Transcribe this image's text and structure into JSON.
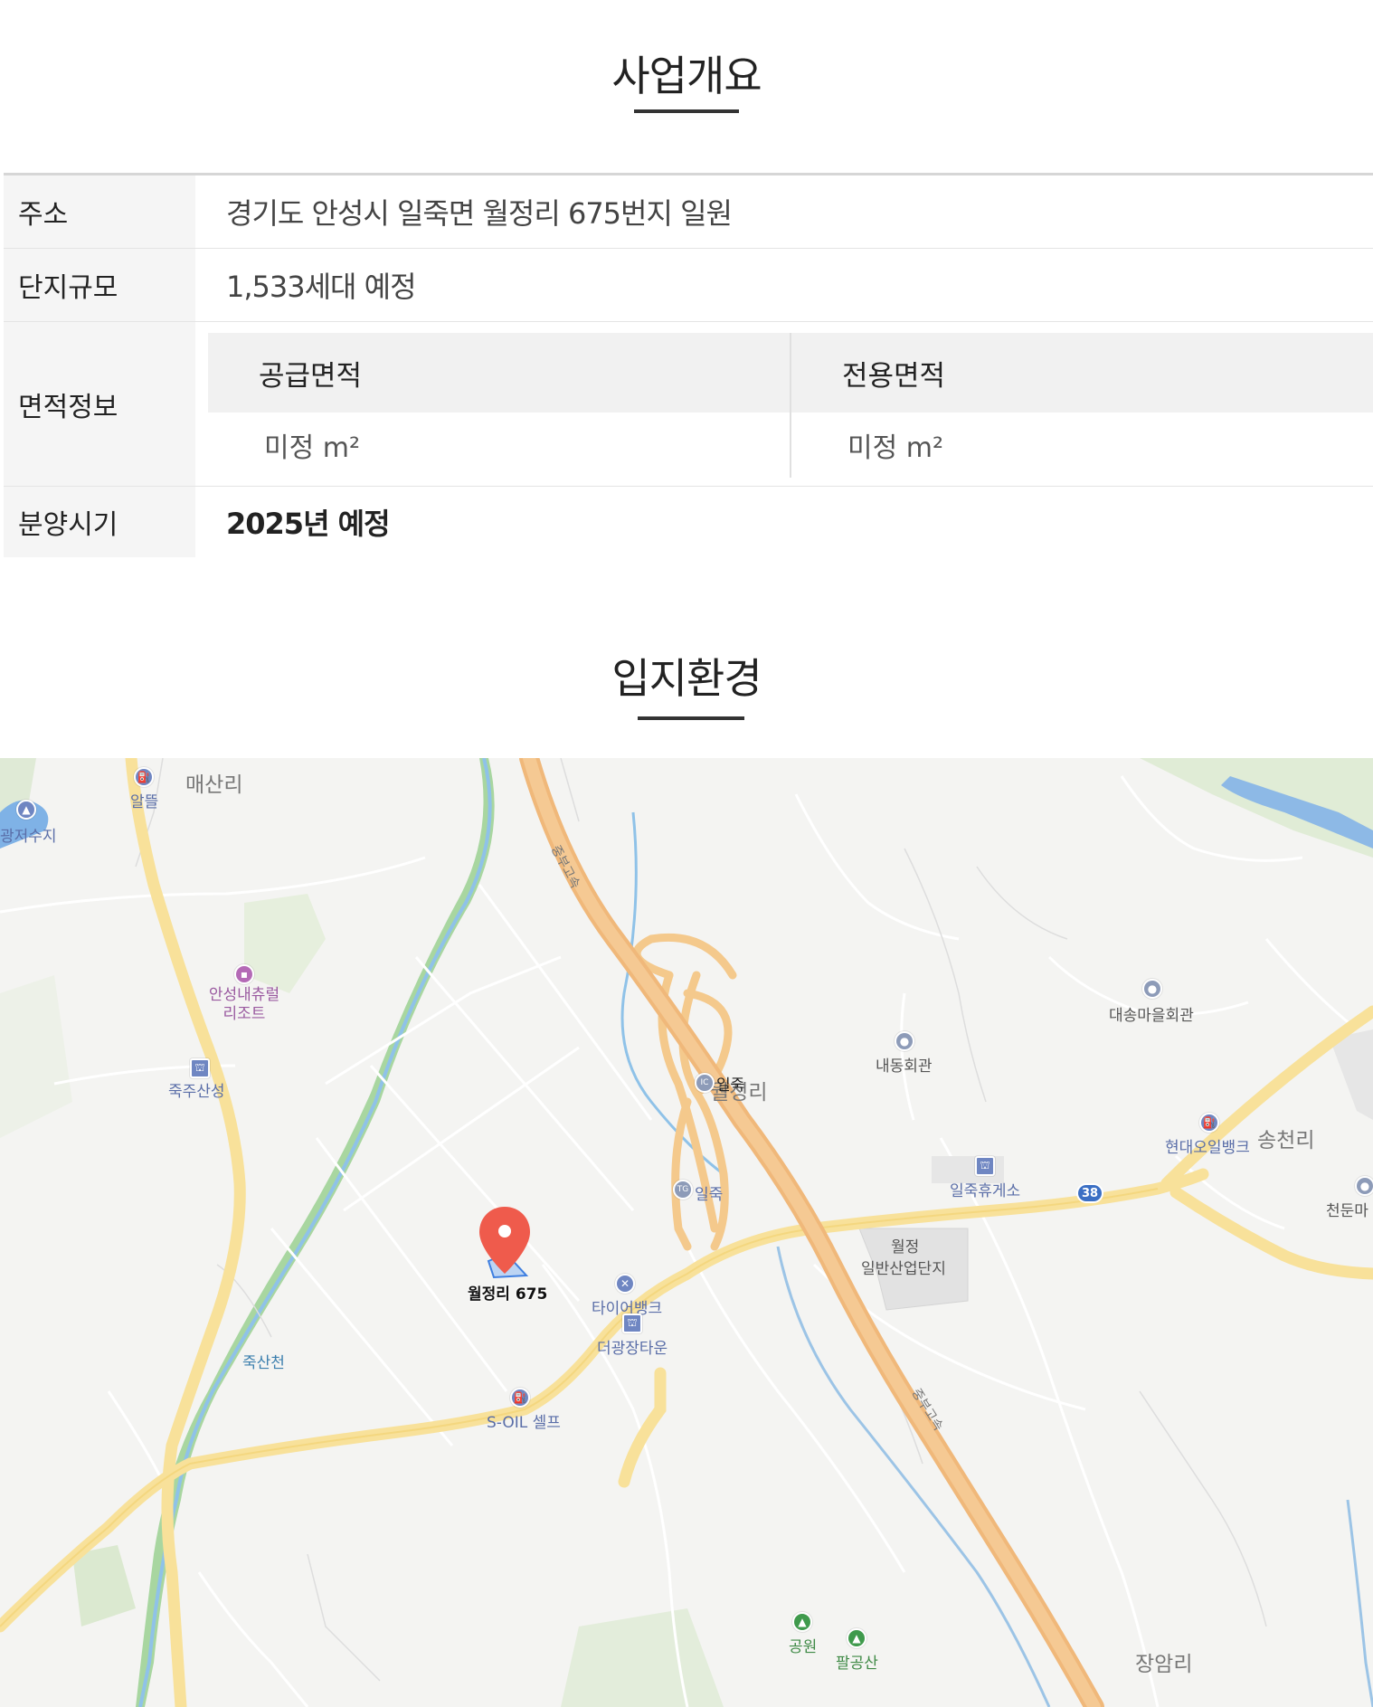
{
  "overview": {
    "title": "사업개요",
    "rows": {
      "address": {
        "label": "주소",
        "value": "경기도 안성시 일죽면 월정리 675번지 일원"
      },
      "scale": {
        "label": "단지규모",
        "value": "1,533세대 예정"
      },
      "area": {
        "label": "면적정보",
        "supply_label": "공급면적",
        "supply_value": "미정 m²",
        "exclusive_label": "전용면적",
        "exclusive_value": "미정 m²"
      },
      "sale": {
        "label": "분양시기",
        "value": "2025년 예정"
      }
    }
  },
  "location": {
    "title": "입지환경",
    "map": {
      "marker_label": "월정리 675",
      "labels": {
        "maesanri": "매산리",
        "altteul": "알뜰",
        "reservoir": "광저수지",
        "resort": "안성내츄럴\n리조트",
        "jukjusanseong": "죽주산성",
        "wolgeongri": "월정리",
        "ic": "일죽",
        "tg": "일죽",
        "naedong": "내동회관",
        "daesong": "대송마을회관",
        "hyundai_oilbank": "현대오일뱅크",
        "songcheonri": "송천리",
        "cheondun": "천둔마",
        "rest_area": "일죽휴게소",
        "route_38": "38",
        "industrial_1": "월정",
        "industrial_2": "일반산업단지",
        "tirebank": "타이어뱅크",
        "gwangjang": "더광장타운",
        "soil": "S-OIL 셀프",
        "juksancheon": "죽산천",
        "expressway_1": "중부고속",
        "expressway_2": "중부고속",
        "park": "공원",
        "palgongsan": "팔공산",
        "jangamri": "장암리"
      }
    }
  }
}
